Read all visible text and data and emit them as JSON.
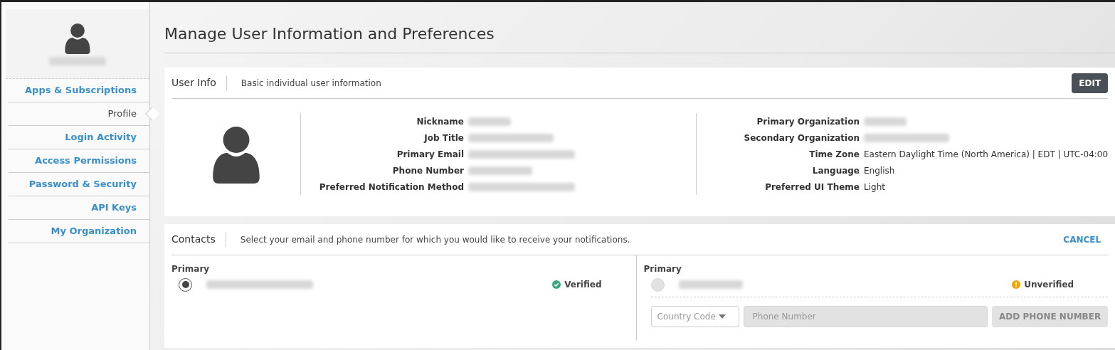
{
  "sidebar": {
    "items": [
      {
        "label": "Apps & Subscriptions",
        "selected": false
      },
      {
        "label": "Profile",
        "selected": true
      },
      {
        "label": "Login Activity",
        "selected": false
      },
      {
        "label": "Access Permissions",
        "selected": false
      },
      {
        "label": "Password & Security",
        "selected": false
      },
      {
        "label": "API Keys",
        "selected": false
      },
      {
        "label": "My Organization",
        "selected": false
      }
    ]
  },
  "title": "Manage User Information and Preferences",
  "user_info": {
    "heading": "User Info",
    "description": "Basic individual user information",
    "edit_button": "EDIT",
    "left_fields": [
      {
        "label": "Nickname",
        "redacted": true
      },
      {
        "label": "Job Title",
        "redacted": true
      },
      {
        "label": "Primary Email",
        "redacted": true
      },
      {
        "label": "Phone Number",
        "redacted": true
      },
      {
        "label": "Preferred Notification Method",
        "redacted": true
      }
    ],
    "right_fields": [
      {
        "label": "Primary Organization",
        "redacted": true
      },
      {
        "label": "Secondary Organization",
        "redacted": true
      },
      {
        "label": "Time Zone",
        "redacted": false,
        "value": "Eastern Daylight Time (North America) | EDT | UTC-04:00"
      },
      {
        "label": "Language",
        "redacted": false,
        "value": "English"
      },
      {
        "label": "Preferred UI Theme",
        "redacted": false,
        "value": "Light"
      }
    ]
  },
  "contacts": {
    "heading": "Contacts",
    "description": "Select your email and phone number for which you would like to receive your notifications.",
    "cancel": "CANCEL",
    "columns": [
      {
        "label": "Primary",
        "selected": true,
        "disabled": false,
        "status": {
          "kind": "verified",
          "label": "Verified"
        }
      },
      {
        "label": "Primary",
        "selected": false,
        "disabled": true,
        "status": {
          "kind": "unverified",
          "label": "Unverified"
        }
      }
    ],
    "country_code": {
      "placeholder": "Country Code"
    },
    "phone": {
      "placeholder": "Phone Number"
    },
    "add_button": "ADD PHONE NUMBER"
  }
}
